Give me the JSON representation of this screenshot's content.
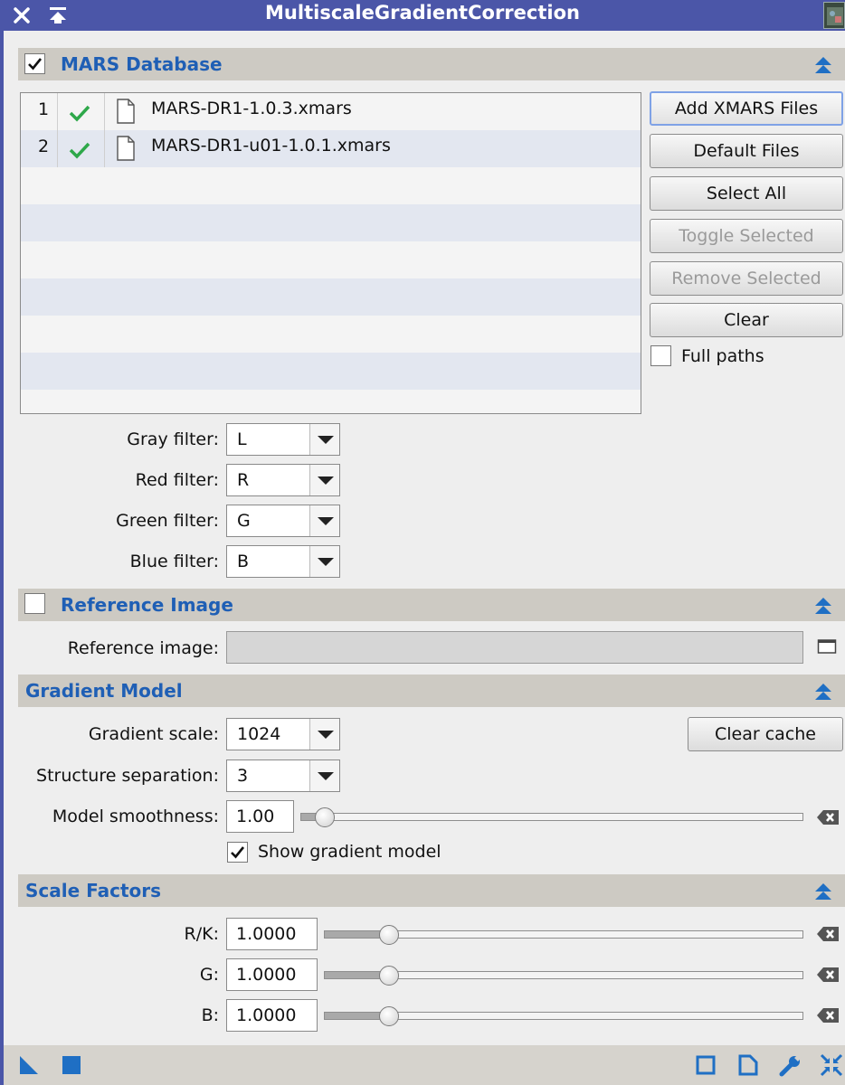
{
  "window": {
    "title": "MultiscaleGradientCorrection"
  },
  "mars_section": {
    "title": "MARS Database",
    "enabled": true,
    "files": [
      {
        "index": "1",
        "name": "MARS-DR1-1.0.3.xmars"
      },
      {
        "index": "2",
        "name": "MARS-DR1-u01-1.0.1.xmars"
      }
    ],
    "buttons": {
      "add": "Add XMARS Files",
      "default_files": "Default Files",
      "select_all": "Select All",
      "toggle_selected": "Toggle Selected",
      "remove_selected": "Remove Selected",
      "clear": "Clear"
    },
    "full_paths_label": "Full paths",
    "full_paths_checked": false,
    "filters": [
      {
        "label": "Gray filter:",
        "value": "L"
      },
      {
        "label": "Red filter:",
        "value": "R"
      },
      {
        "label": "Green filter:",
        "value": "G"
      },
      {
        "label": "Blue filter:",
        "value": "B"
      }
    ]
  },
  "reference_section": {
    "title": "Reference Image",
    "enabled": false,
    "field_label": "Reference image:",
    "field_value": ""
  },
  "gradient_section": {
    "title": "Gradient Model",
    "scale_label": "Gradient scale:",
    "scale_value": "1024",
    "clear_cache": "Clear cache",
    "separation_label": "Structure separation:",
    "separation_value": "3",
    "smoothness_label": "Model smoothness:",
    "smoothness_value": "1.00",
    "smoothness_slider_fraction": 0.03,
    "show_model_label": "Show gradient model",
    "show_model_checked": true
  },
  "scale_section": {
    "title": "Scale Factors",
    "factors": [
      {
        "label": "R/K:",
        "value": "1.0000",
        "slider_fraction": 0.12
      },
      {
        "label": "G:",
        "value": "1.0000",
        "slider_fraction": 0.12
      },
      {
        "label": "B:",
        "value": "1.0000",
        "slider_fraction": 0.12
      }
    ]
  },
  "icons": {
    "close": "close-icon",
    "shade": "shade-icon",
    "collapse": "collapse-icon",
    "new_instance": "new-instance-icon",
    "apply_global": "apply-global-icon",
    "preview": "preview-icon",
    "document": "document-icon",
    "settings": "wrench-icon",
    "reset": "reset-icon",
    "reset_value": "backspace-icon"
  },
  "colors": {
    "titlebar": "#4b56a8",
    "section_title": "#1f5fb5",
    "check_ok": "#2ea84a",
    "accent_blue": "#1f6fc4"
  }
}
